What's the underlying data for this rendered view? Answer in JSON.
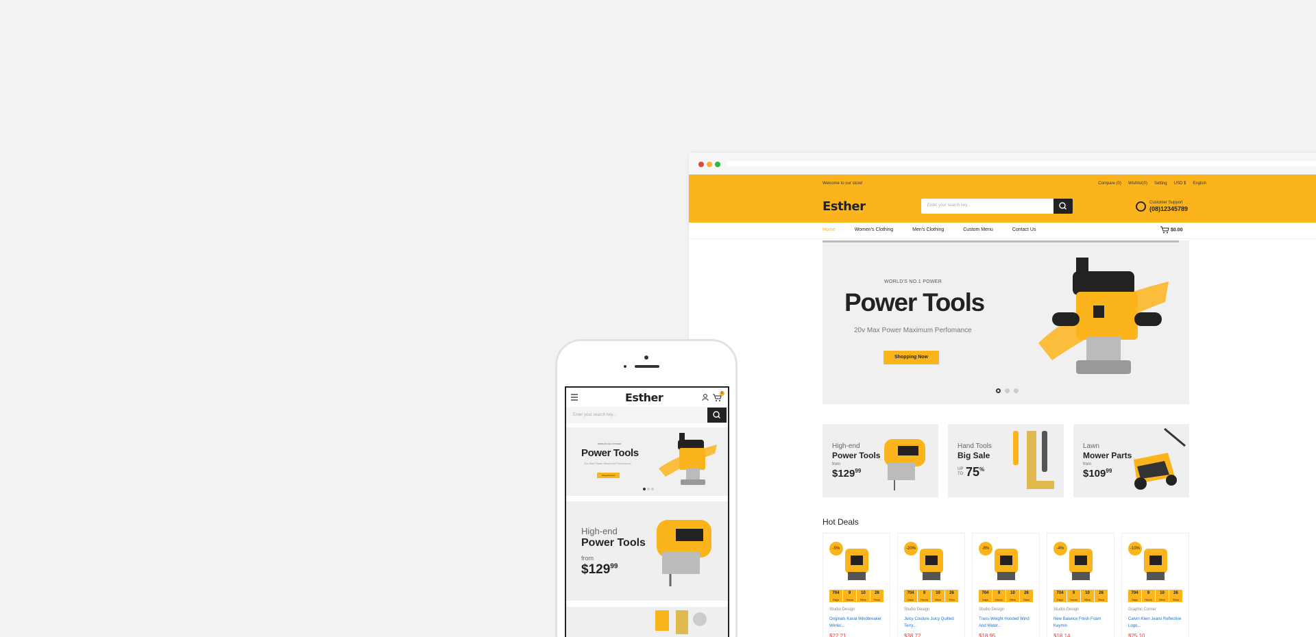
{
  "browser": {
    "traffic_colors": [
      "#e0443e",
      "#f4b22a",
      "#2bb53a"
    ]
  },
  "topbar": {
    "welcome": "Welcome to our store!",
    "links": [
      "Compare (0)",
      "Wishlist(0)",
      "Setting",
      "USD $",
      "English"
    ]
  },
  "header": {
    "logo": "Esther",
    "search_placeholder": "Enter your search key...",
    "support_label": "Customer Support",
    "support_phone": "(08)12345789"
  },
  "nav": {
    "items": [
      "Home",
      "Women's Clothing",
      "Men's Clothing",
      "Custom Menu",
      "Contact Us"
    ],
    "cart_count": "0",
    "cart_total": "$0.00"
  },
  "hero": {
    "subtitle": "WORLD'S NO.1 POWER",
    "title": "Power Tools",
    "tagline": "20v Max Power Maximum Perfomance",
    "cta": "Shopping Now"
  },
  "banners": [
    {
      "line1": "High-end",
      "line2": "Power Tools",
      "from": "from",
      "price": "$129",
      "cents": "99"
    },
    {
      "line1": "Hand Tools",
      "line2": "Big Sale",
      "upto": "UP TO",
      "price": "75",
      "cents": "%"
    },
    {
      "line1": "Lawn",
      "line2": "Mower Parts",
      "from": "from",
      "price": "$109",
      "cents": "99"
    }
  ],
  "hot_deals": {
    "heading": "Hot Deals",
    "countdown_labels": [
      "Days",
      "Hours",
      "Mins",
      "Secs"
    ],
    "countdown_values": [
      "704",
      "9",
      "10",
      "26"
    ],
    "products": [
      {
        "badge": "-5%",
        "brand": "Studio Design",
        "name": "Originals Kaval Windbreaker Winter...",
        "price": "$22.21"
      },
      {
        "badge": "-20%",
        "brand": "Studio Design",
        "name": "Juicy Couture Juicy Quilted Terry...",
        "price": "$38.72"
      },
      {
        "badge": "-8%",
        "brand": "Studio Design",
        "name": "Trans-Weight Hooded Wind And Water...",
        "price": "$18.95"
      },
      {
        "badge": "-4%",
        "brand": "Studio Design",
        "name": "New Balance Fresh Foam Kaymin",
        "price": "$18.14"
      },
      {
        "badge": "-10%",
        "brand": "Graphic Corner",
        "name": "Calvin Klein Jeans Reflective Logo...",
        "price": "$25.10"
      }
    ]
  },
  "mobile": {
    "logo": "Esther",
    "cart_count": "0",
    "search_placeholder": "Enter your search key...",
    "hero_sub": "WORLD'S NO.1 POWER",
    "hero_title": "Power Tools",
    "hero_tag": "20v Max Power Maximum Perfomance",
    "hero_cta": "Shopping Now",
    "banner_line1": "High-end",
    "banner_line2": "Power Tools",
    "banner_from": "from",
    "banner_price": "$129",
    "banner_cents": "99"
  },
  "colors": {
    "accent": "#fcb41c",
    "dark": "#222222",
    "link": "#1f6fcf",
    "price": "#e33333"
  }
}
